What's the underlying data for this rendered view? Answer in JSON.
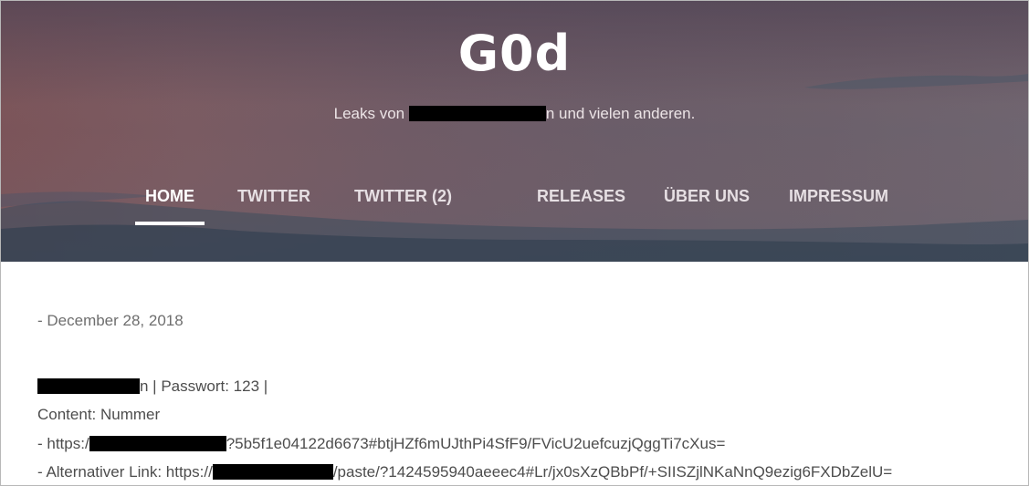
{
  "blog": {
    "title": "G0d",
    "tagline_prefix": "Leaks von",
    "tagline_suffix": "n und vielen anderen."
  },
  "nav": {
    "items": [
      {
        "label": "HOME",
        "active": true
      },
      {
        "label": "TWITTER",
        "active": false
      },
      {
        "label": "TWITTER (2)",
        "active": false
      },
      {
        "label": "RELEASES",
        "active": false
      },
      {
        "label": "ÜBER UNS",
        "active": false
      },
      {
        "label": "IMPRESSUM",
        "active": false
      }
    ]
  },
  "post": {
    "date": "- December 28, 2018",
    "credentials_suffix": "n | Passwort: 123 |",
    "content_line": "Content: Nummer",
    "link1_prefix": "- https:/",
    "link1_suffix": "?5b5f1e04122d6673#btjHZf6mUJthPi4SfF9/FVicU2uefcuzjQggTi7cXus=",
    "link2_prefix": "- Alternativer Link: https://",
    "link2_suffix": "/paste/?1424595940aeeec4#Lr/jx0sXzQBbPf/+SIISZjlNKaNnQ9ezig6FXDbZelU="
  },
  "colors": {
    "hero_mauve": "#7a5b62",
    "active_underline": "#ffffff",
    "redaction": "#000000"
  }
}
